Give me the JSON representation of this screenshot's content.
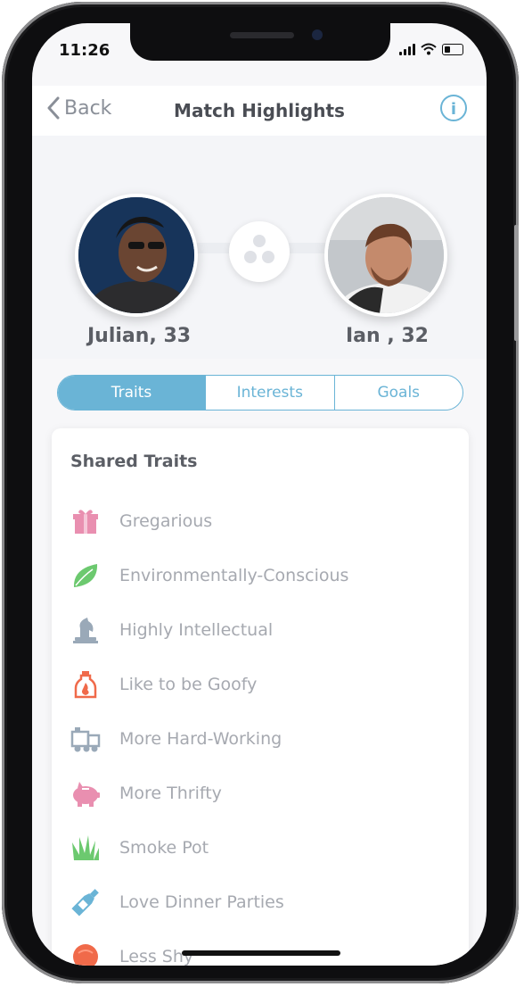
{
  "status": {
    "time": "11:26"
  },
  "nav": {
    "back_label": "Back",
    "title": "Match Highlights",
    "info_label": "i"
  },
  "match": {
    "person1": {
      "name": "Julian, 33"
    },
    "person2": {
      "name": "Ian , 32"
    }
  },
  "tabs": [
    {
      "label": "Traits",
      "active": true
    },
    {
      "label": "Interests",
      "active": false
    },
    {
      "label": "Goals",
      "active": false
    }
  ],
  "shared": {
    "title": "Shared Traits",
    "traits": [
      {
        "label": "Gregarious",
        "icon": "gift-icon",
        "color": "#e98fb0"
      },
      {
        "label": "Environmentally-Conscious",
        "icon": "leaf-icon",
        "color": "#6cc96f"
      },
      {
        "label": "Highly Intellectual",
        "icon": "chess-knight-icon",
        "color": "#9aa9b8"
      },
      {
        "label": "Like to be Goofy",
        "icon": "hot-sauce-icon",
        "color": "#f06a4a"
      },
      {
        "label": "More Hard-Working",
        "icon": "train-icon",
        "color": "#9aa9b8"
      },
      {
        "label": "More Thrifty",
        "icon": "piggy-bank-icon",
        "color": "#e98fb0"
      },
      {
        "label": "Smoke Pot",
        "icon": "grass-icon",
        "color": "#6cc96f"
      },
      {
        "label": "Love Dinner Parties",
        "icon": "wine-bottle-icon",
        "color": "#6ab4d6"
      },
      {
        "label": "Less Shy",
        "icon": "circle-icon",
        "color": "#f06a4a"
      }
    ]
  },
  "colors": {
    "accent": "#6ab4d6",
    "text_dark": "#5b5e65",
    "text_light": "#a6a9b0"
  }
}
